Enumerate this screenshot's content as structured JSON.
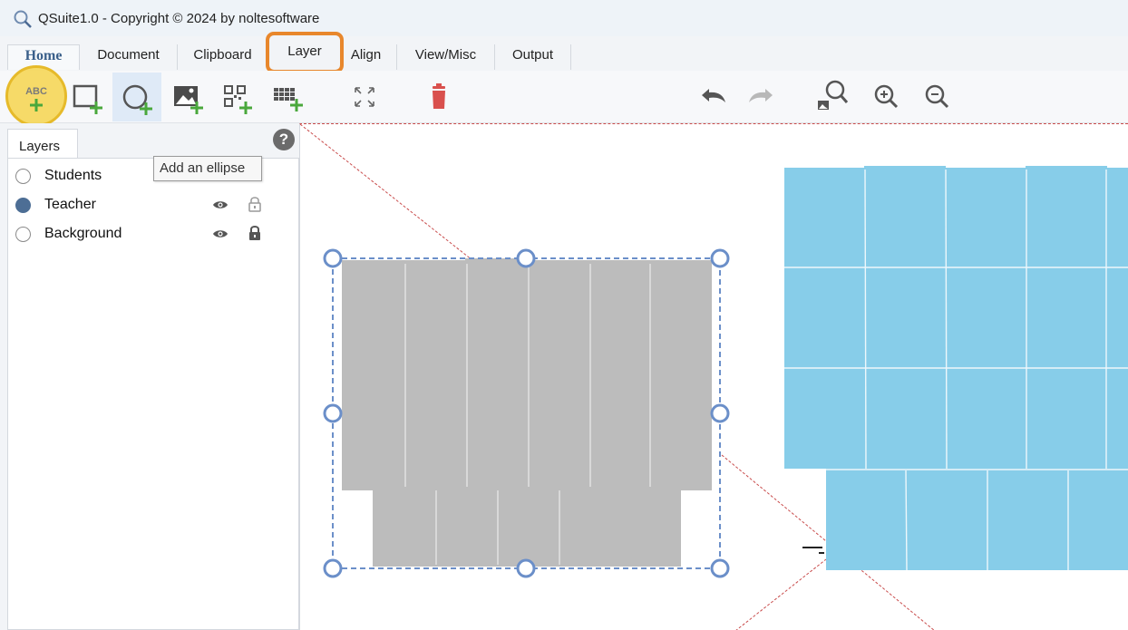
{
  "window": {
    "title": "QSuite1.0 - Copyright © 2024 by noltesoftware"
  },
  "tabs": [
    {
      "label": "Home"
    },
    {
      "label": "Document"
    },
    {
      "label": "Clipboard"
    },
    {
      "label": "Layer"
    },
    {
      "label": "Align"
    },
    {
      "label": "View/Misc"
    },
    {
      "label": "Output"
    }
  ],
  "toolbar": {
    "add_text_label": "ABC",
    "buttons": [
      "add-text",
      "add-rectangle",
      "add-ellipse",
      "add-image",
      "add-qrcode",
      "add-grid",
      "fit-page",
      "delete",
      "undo",
      "redo",
      "zoom-to-fit",
      "zoom-in",
      "zoom-out"
    ]
  },
  "tooltip": {
    "text": "Add an ellipse"
  },
  "layers_panel": {
    "tab_label": "Layers",
    "help_icon": "?",
    "layers": [
      {
        "name": "Students",
        "selected": false
      },
      {
        "name": "Teacher",
        "selected": true,
        "visible": true,
        "locked": false
      },
      {
        "name": "Background",
        "selected": false,
        "visible": true,
        "locked": true
      }
    ]
  },
  "colors": {
    "accent_highlight": "#e8872c",
    "button_highlight": "#f5d037",
    "selection_handle": "#6b8fc9",
    "gray_cards": "#bcbcbc",
    "blue_cards": "#87cde9",
    "delete_red": "#d9504d",
    "add_green": "#4aa83c"
  }
}
